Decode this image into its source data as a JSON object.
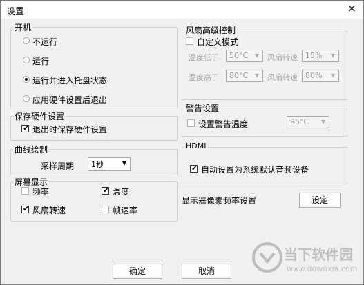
{
  "dialog": {
    "title": "设置"
  },
  "startup": {
    "legend": "开机",
    "options": [
      "不运行",
      "运行",
      "运行并进入托盘状态",
      "应用硬件设置后退出"
    ],
    "selected_index": 2
  },
  "save_hw": {
    "legend": "保存硬件设置",
    "checkbox_label": "退出时保存硬件设置",
    "checked": true
  },
  "curve": {
    "legend": "曲线绘制",
    "label": "采样周期",
    "select_value": "1秒"
  },
  "display": {
    "legend": "屏幕显示",
    "items": [
      {
        "label": "频率",
        "checked": false
      },
      {
        "label": "温度",
        "checked": true
      },
      {
        "label": "风扇转速",
        "checked": true
      },
      {
        "label": "帧速率",
        "checked": false
      }
    ]
  },
  "fan": {
    "legend": "风扇高级控制",
    "custom_label": "自定义模式",
    "custom_checked": false,
    "rows": [
      {
        "temp_label": "温度低于",
        "temp_value": "50°C",
        "speed_label": "风扇转速",
        "speed_value": "15%"
      },
      {
        "temp_label": "温度高于",
        "temp_value": "80°C",
        "speed_label": "风扇转速",
        "speed_value": "80%"
      }
    ]
  },
  "alarm": {
    "legend": "警告设置",
    "checkbox_label": "设置警告温度",
    "checked": false,
    "select_value": "95°C"
  },
  "hdmi": {
    "legend": "HDMI",
    "checkbox_label": "自动设置为系统默认音频设备",
    "checked": true
  },
  "refresh": {
    "label": "显示器像素频率设置",
    "button": "设定"
  },
  "buttons": {
    "ok": "确定",
    "cancel": "取消"
  },
  "watermark": {
    "text": "当下软件园",
    "url": "www.downxia.com"
  }
}
